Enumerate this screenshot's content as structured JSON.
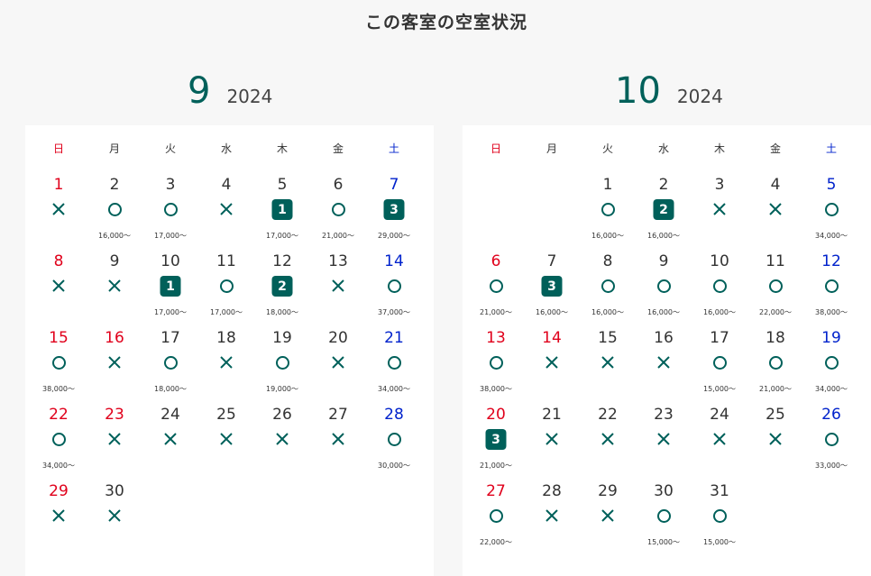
{
  "title": "この客室の空室状況",
  "legend": {
    "circle": "○",
    "cross": "×"
  },
  "colors": {
    "accent": "#00605a",
    "sunday": "#e0001b",
    "saturday": "#0022cc"
  },
  "months": [
    {
      "month": "9",
      "year": "2024",
      "weekdays": [
        "日",
        "月",
        "火",
        "水",
        "木",
        "金",
        "土"
      ],
      "weeks": [
        [
          {
            "d": "1",
            "s": "x",
            "p": ""
          },
          {
            "d": "2",
            "s": "o",
            "p": "16,000～"
          },
          {
            "d": "3",
            "s": "o",
            "p": "17,000～"
          },
          {
            "d": "4",
            "s": "x",
            "p": ""
          },
          {
            "d": "5",
            "s": "1",
            "p": "17,000～"
          },
          {
            "d": "6",
            "s": "o",
            "p": "21,000～"
          },
          {
            "d": "7",
            "s": "3",
            "p": "29,000～"
          }
        ],
        [
          {
            "d": "8",
            "s": "x",
            "p": ""
          },
          {
            "d": "9",
            "s": "x",
            "p": ""
          },
          {
            "d": "10",
            "s": "1",
            "p": "17,000～"
          },
          {
            "d": "11",
            "s": "o",
            "p": "17,000～"
          },
          {
            "d": "12",
            "s": "2",
            "p": "18,000～"
          },
          {
            "d": "13",
            "s": "x",
            "p": ""
          },
          {
            "d": "14",
            "s": "o",
            "p": "37,000～"
          }
        ],
        [
          {
            "d": "15",
            "s": "o",
            "p": "38,000～"
          },
          {
            "d": "16",
            "s": "x",
            "p": "",
            "hol": true
          },
          {
            "d": "17",
            "s": "o",
            "p": "18,000～"
          },
          {
            "d": "18",
            "s": "x",
            "p": ""
          },
          {
            "d": "19",
            "s": "o",
            "p": "19,000～"
          },
          {
            "d": "20",
            "s": "x",
            "p": ""
          },
          {
            "d": "21",
            "s": "o",
            "p": "34,000～"
          }
        ],
        [
          {
            "d": "22",
            "s": "o",
            "p": "34,000～"
          },
          {
            "d": "23",
            "s": "x",
            "p": "",
            "hol": true
          },
          {
            "d": "24",
            "s": "x",
            "p": ""
          },
          {
            "d": "25",
            "s": "x",
            "p": ""
          },
          {
            "d": "26",
            "s": "x",
            "p": ""
          },
          {
            "d": "27",
            "s": "x",
            "p": ""
          },
          {
            "d": "28",
            "s": "o",
            "p": "30,000～"
          }
        ],
        [
          {
            "d": "29",
            "s": "x",
            "p": ""
          },
          {
            "d": "30",
            "s": "x",
            "p": ""
          },
          null,
          null,
          null,
          null,
          null
        ]
      ]
    },
    {
      "month": "10",
      "year": "2024",
      "weekdays": [
        "日",
        "月",
        "火",
        "水",
        "木",
        "金",
        "土"
      ],
      "weeks": [
        [
          null,
          null,
          {
            "d": "1",
            "s": "o",
            "p": "16,000～"
          },
          {
            "d": "2",
            "s": "2",
            "p": "16,000～"
          },
          {
            "d": "3",
            "s": "x",
            "p": ""
          },
          {
            "d": "4",
            "s": "x",
            "p": ""
          },
          {
            "d": "5",
            "s": "o",
            "p": "34,000～"
          }
        ],
        [
          {
            "d": "6",
            "s": "o",
            "p": "21,000～"
          },
          {
            "d": "7",
            "s": "3",
            "p": "16,000～"
          },
          {
            "d": "8",
            "s": "o",
            "p": "16,000～"
          },
          {
            "d": "9",
            "s": "o",
            "p": "16,000～"
          },
          {
            "d": "10",
            "s": "o",
            "p": "16,000～"
          },
          {
            "d": "11",
            "s": "o",
            "p": "22,000～"
          },
          {
            "d": "12",
            "s": "o",
            "p": "38,000～"
          }
        ],
        [
          {
            "d": "13",
            "s": "o",
            "p": "38,000～"
          },
          {
            "d": "14",
            "s": "x",
            "p": "",
            "hol": true
          },
          {
            "d": "15",
            "s": "x",
            "p": ""
          },
          {
            "d": "16",
            "s": "x",
            "p": ""
          },
          {
            "d": "17",
            "s": "o",
            "p": "15,000～"
          },
          {
            "d": "18",
            "s": "o",
            "p": "21,000～"
          },
          {
            "d": "19",
            "s": "o",
            "p": "34,000～"
          }
        ],
        [
          {
            "d": "20",
            "s": "3",
            "p": "21,000～"
          },
          {
            "d": "21",
            "s": "x",
            "p": ""
          },
          {
            "d": "22",
            "s": "x",
            "p": ""
          },
          {
            "d": "23",
            "s": "x",
            "p": ""
          },
          {
            "d": "24",
            "s": "x",
            "p": ""
          },
          {
            "d": "25",
            "s": "x",
            "p": ""
          },
          {
            "d": "26",
            "s": "o",
            "p": "33,000～"
          }
        ],
        [
          {
            "d": "27",
            "s": "o",
            "p": "22,000～"
          },
          {
            "d": "28",
            "s": "x",
            "p": ""
          },
          {
            "d": "29",
            "s": "x",
            "p": ""
          },
          {
            "d": "30",
            "s": "o",
            "p": "15,000～"
          },
          {
            "d": "31",
            "s": "o",
            "p": "15,000～"
          },
          null,
          null
        ]
      ]
    }
  ]
}
